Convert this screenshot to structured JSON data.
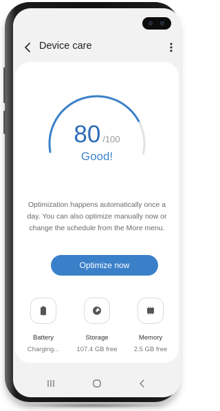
{
  "header": {
    "back_icon": "chevron-left-icon",
    "title": "Device care",
    "more_icon": "more-vertical-icon"
  },
  "score": {
    "value": "80",
    "max": "/100",
    "status": "Good!",
    "fill_fraction": 0.8
  },
  "description": "Optimization happens automatically once a day. You can also optimize manually now or change the schedule from the More menu.",
  "optimize_button": "Optimize now",
  "features": [
    {
      "icon": "battery-icon",
      "label": "Battery",
      "value": "Charging..."
    },
    {
      "icon": "storage-icon",
      "label": "Storage",
      "value": "107.4 GB free"
    },
    {
      "icon": "memory-icon",
      "label": "Memory",
      "value": "2.5 GB free"
    }
  ],
  "navbar": {
    "recents_icon": "recents-icon",
    "home_icon": "home-icon",
    "back_icon": "back-icon"
  },
  "colors": {
    "accent": "#3a80c9",
    "score_text": "#2e6bb8",
    "gauge_track": "#e2e2e2"
  }
}
